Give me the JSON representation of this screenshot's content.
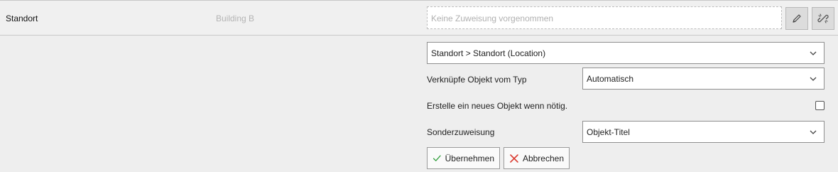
{
  "field": {
    "label": "Standort",
    "value": "Building B",
    "assignment_placeholder": "Keine Zuweisung vorgenommen"
  },
  "icons": {
    "edit": "pencil-icon",
    "unlink": "unlink-icon",
    "chevron": "chevron-down-icon",
    "apply": "check-icon",
    "cancel": "close-icon"
  },
  "form": {
    "location_select": "Standort > Standort (Location)",
    "link_type_label": "Verknüpfe Objekt vom Typ",
    "link_type_value": "Automatisch",
    "create_new_label": "Erstelle ein neues Objekt wenn nötig.",
    "create_new_checked": false,
    "special_assign_label": "Sonderzuweisung",
    "special_assign_value": "Objekt-Titel"
  },
  "buttons": {
    "apply_label": "Übernehmen",
    "cancel_label": "Abbrechen"
  },
  "colors": {
    "apply_check": "#2e9e3a",
    "cancel_x": "#d9362b"
  }
}
